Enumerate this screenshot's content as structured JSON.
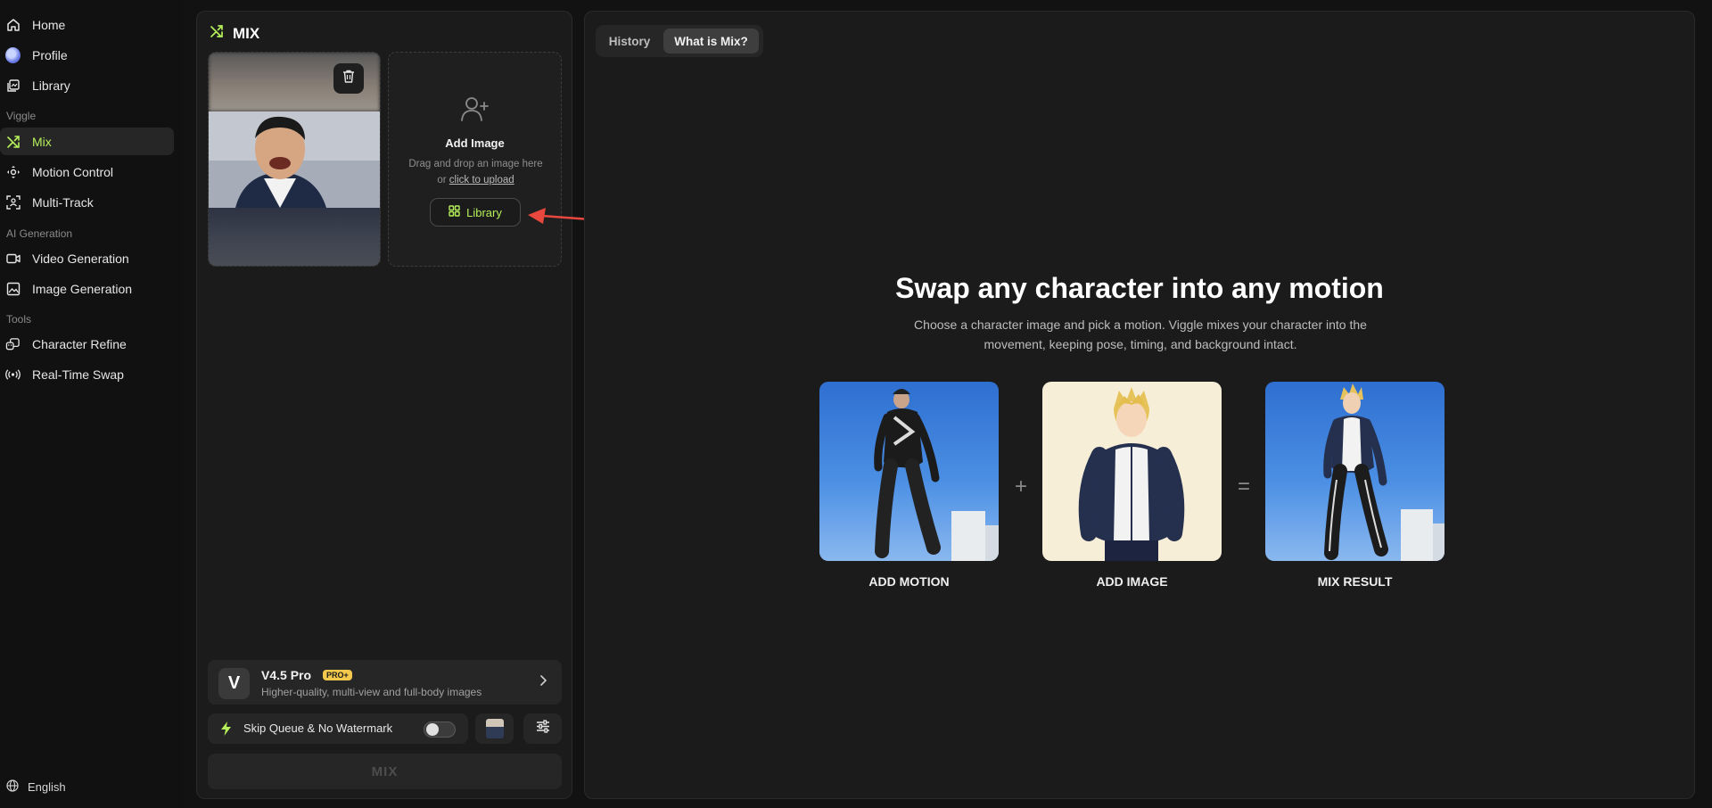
{
  "sidebar": {
    "nav": [
      {
        "label": "Home",
        "icon": "home-icon"
      },
      {
        "label": "Profile",
        "icon": "avatar"
      },
      {
        "label": "Library",
        "icon": "library-icon"
      }
    ],
    "section_viggle": "Viggle",
    "viggle_items": [
      {
        "label": "Mix",
        "icon": "shuffle-icon",
        "active": true
      },
      {
        "label": "Motion Control",
        "icon": "motion-icon"
      },
      {
        "label": "Multi-Track",
        "icon": "multi-track-icon"
      }
    ],
    "section_ai": "AI Generation",
    "ai_items": [
      {
        "label": "Video Generation",
        "icon": "video-icon"
      },
      {
        "label": "Image Generation",
        "icon": "image-icon"
      }
    ],
    "section_tools": "Tools",
    "tool_items": [
      {
        "label": "Character Refine",
        "icon": "refine-icon"
      },
      {
        "label": "Real-Time Swap",
        "icon": "broadcast-icon"
      }
    ],
    "language": "English"
  },
  "mix_panel": {
    "title": "MIX",
    "add_image": {
      "title": "Add Image",
      "desc_prefix": "Drag and drop an image here or",
      "desc_link": "click to upload",
      "library_button": "Library"
    },
    "model": {
      "name": "V4.5 Pro",
      "badge": "PRO+",
      "description": "Higher-quality, multi-view and full-body images",
      "logo_letter": "V"
    },
    "skip_queue_label": "Skip Queue & No Watermark",
    "skip_queue_on": false,
    "mix_button": "MIX"
  },
  "right_panel": {
    "tabs": [
      {
        "label": "History",
        "active": false
      },
      {
        "label": "What is Mix?",
        "active": true
      }
    ],
    "hero_title": "Swap any character into any motion",
    "hero_subtitle": "Choose a character image and pick a motion. Viggle mixes your character into the movement, keeping pose, timing, and background intact.",
    "steps": [
      {
        "caption": "ADD MOTION"
      },
      {
        "caption": "ADD IMAGE"
      },
      {
        "caption": "MIX RESULT"
      }
    ],
    "plus": "+",
    "equals": "="
  },
  "colors": {
    "accent": "#b5f05a",
    "background": "#121212",
    "panel": "#1b1b1b",
    "arrow": "#e8473e",
    "badge": "#f2c94c"
  }
}
